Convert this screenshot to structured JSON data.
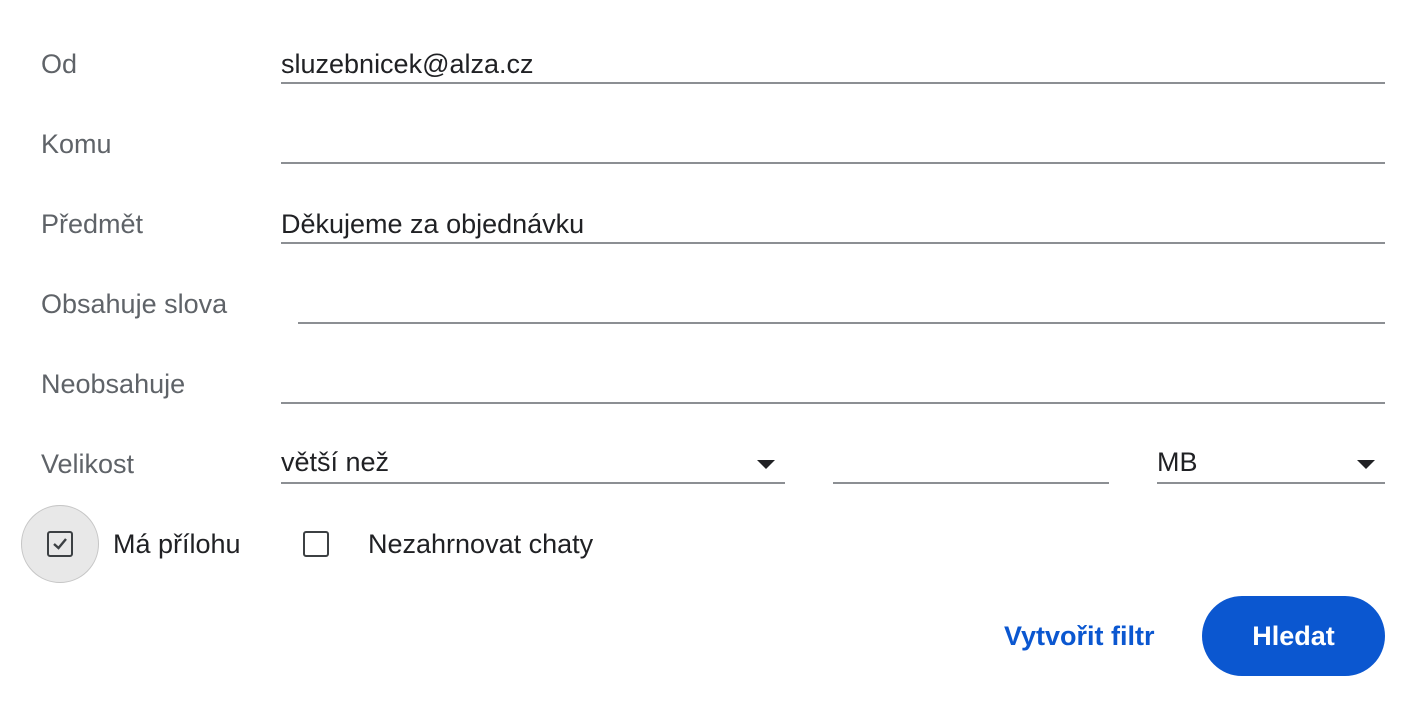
{
  "form": {
    "from": {
      "label": "Od",
      "value": "sluzebnicek@alza.cz"
    },
    "to": {
      "label": "Komu",
      "value": ""
    },
    "subject": {
      "label": "Předmět",
      "value": "Děkujeme za objednávku"
    },
    "has_words": {
      "label": "Obsahuje slova",
      "value": ""
    },
    "doesnt_have": {
      "label": "Neobsahuje",
      "value": ""
    },
    "size": {
      "label": "Velikost",
      "operator": "větší než",
      "value": "",
      "unit": "MB"
    },
    "has_attachment": {
      "label": "Má přílohu",
      "checked": true
    },
    "exclude_chats": {
      "label": "Nezahrnovat chaty",
      "checked": false
    }
  },
  "actions": {
    "create_filter": "Vytvořit filtr",
    "search": "Hledat"
  },
  "colors": {
    "primary": "#0b57d0",
    "label": "#5f6368",
    "text": "#202124"
  }
}
